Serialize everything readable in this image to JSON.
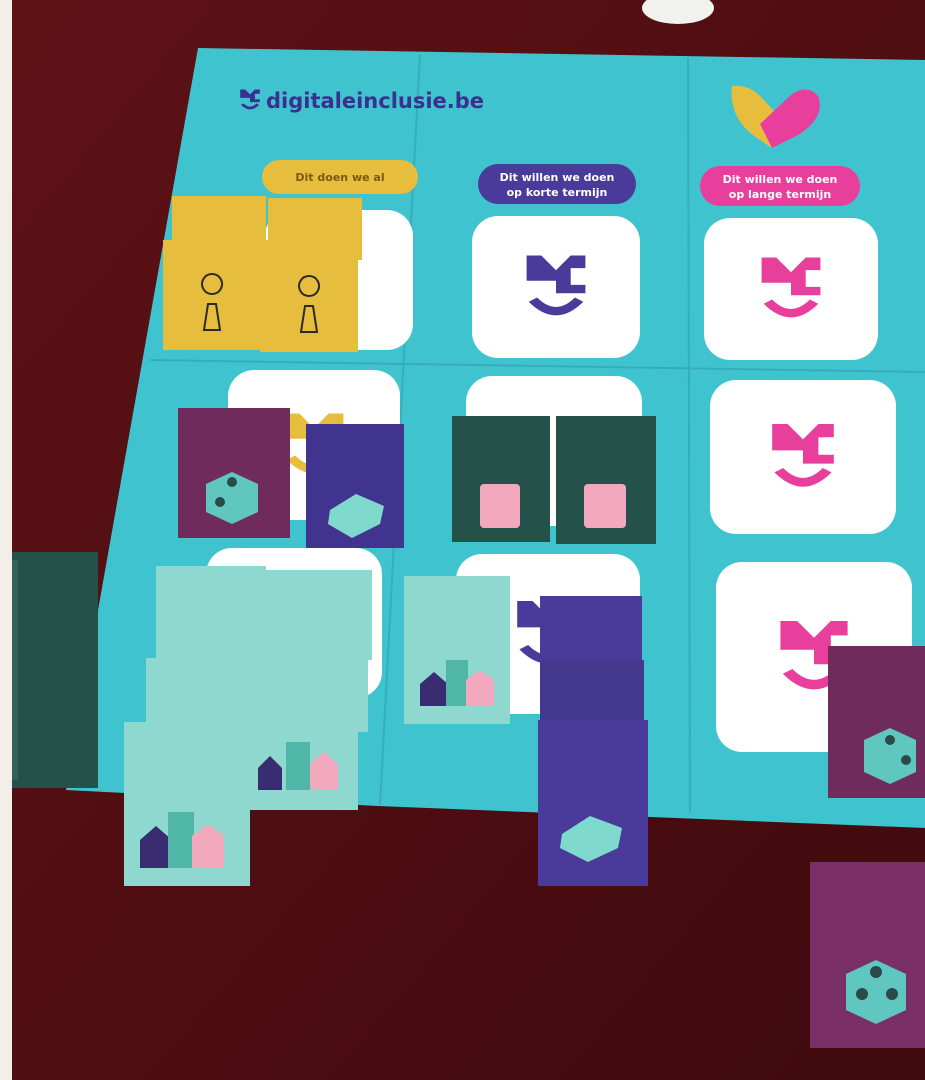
{
  "poster": {
    "brand": "digitaleinclusie.be",
    "columns": [
      {
        "label": "Dit doen we al"
      },
      {
        "label_line1": "Dit willen we doen",
        "label_line2": "op korte termijn"
      },
      {
        "label_line1": "Dit willen we doen",
        "label_line2": "op lange termijn"
      }
    ]
  },
  "colors": {
    "table": "#5b1114",
    "poster": "#3fc4cf",
    "yellow": "#e6bd3c",
    "indigo": "#4a3a9a",
    "magenta": "#e83e9c",
    "plum": "#6e2b5c",
    "forest": "#24524a",
    "mint": "#8fd8cf"
  },
  "icons": [
    "digitaleinclusie-logo-icon",
    "heart-hands-icon",
    "mu-logo-icon",
    "keyhole-icon",
    "cube-icon",
    "money-stack-icon",
    "lego-brick-icon",
    "houses-icon"
  ]
}
